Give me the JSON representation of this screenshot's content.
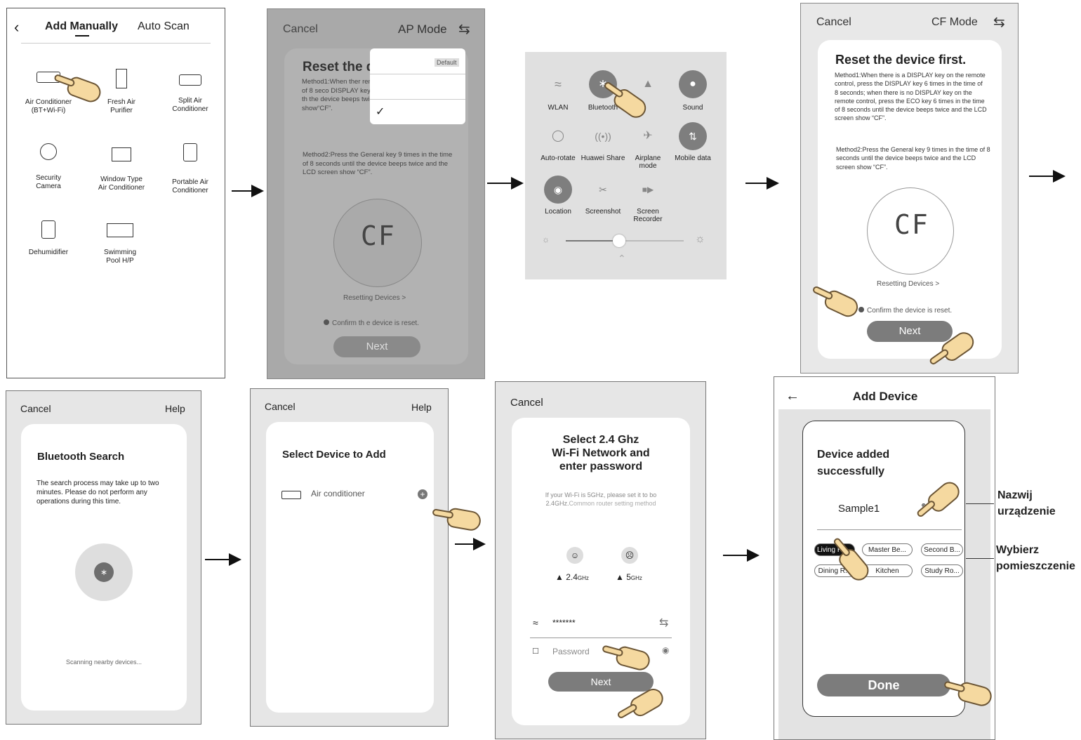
{
  "panel1": {
    "back_icon": "chevron-left-icon",
    "tab_manual": "Add Manually",
    "tab_auto": "Auto Scan",
    "devices": [
      {
        "label_line1": "Air Conditioner",
        "label_line2": "(BT+Wi-Fi)",
        "icon": "air-conditioner-icon"
      },
      {
        "label_line1": "Fresh Air",
        "label_line2": "Purifier",
        "icon": "air-purifier-icon"
      },
      {
        "label_line1": "Split Air",
        "label_line2": "Conditioner",
        "icon": "split-ac-icon"
      },
      {
        "label_line1": "Security",
        "label_line2": "Camera",
        "icon": "camera-icon"
      },
      {
        "label_line1": "Window Type",
        "label_line2": "Air Conditioner",
        "icon": "window-ac-icon"
      },
      {
        "label_line1": "Portable Air",
        "label_line2": "Conditioner",
        "icon": "portable-ac-icon"
      },
      {
        "label_line1": "Dehumidifier",
        "label_line2": "",
        "icon": "dehumidifier-icon"
      },
      {
        "label_line1": "Swimming",
        "label_line2": "Pool H/P",
        "icon": "pool-heat-pump-icon"
      }
    ]
  },
  "panel2": {
    "cancel": "Cancel",
    "mode": "AP Mode",
    "title": "Reset the d",
    "dropdown_default": "Default",
    "method1": "Method1:When ther remote control, pres in the time of 8 seco DISPLAY key on the r ECO key 6 times in th the device beeps twice and the LCD screen show“CF”.",
    "method2": "Method2:Press the General key 9 times in the time of 8 seconds until the device beeps twice and the LCD screen show “CF”.",
    "lcd": "CF",
    "resetting": "Resetting Devices >",
    "confirm": "Confirm th e device is reset.",
    "next": "Next"
  },
  "panel3": {
    "tiles": [
      {
        "label": "WLAN",
        "icon": "wifi-icon"
      },
      {
        "label": "Bluetooth",
        "icon": "bluetooth-icon"
      },
      {
        "label": "",
        "icon": "flashlight-icon"
      },
      {
        "label": "Sound",
        "icon": "bell-icon"
      },
      {
        "label": "Auto-rotate",
        "icon": "rotate-icon"
      },
      {
        "label": "Huawei Share",
        "icon": "share-icon"
      },
      {
        "label": "Airplane mode",
        "icon": "airplane-icon"
      },
      {
        "label": "Mobile data",
        "icon": "mobile-data-icon"
      },
      {
        "label": "Location",
        "icon": "location-icon"
      },
      {
        "label": "Screenshot",
        "icon": "screenshot-icon"
      },
      {
        "label": "Screen Recorder",
        "icon": "screen-recorder-icon"
      }
    ],
    "brightness_level": 0.45
  },
  "panel4": {
    "cancel": "Cancel",
    "mode": "CF Mode",
    "title": "Reset the device first.",
    "method1": "Method1:When there is a DISPLAY key on the remote control, press the DISPLAY key 6 times in the time of 8 seconds; when there is no DISPLAY key on the remote control, press the ECO key 6 times in the time of 8 seconds until the device beeps twice and the LCD screen show “CF”.",
    "method2": "Method2:Press the General key 9 times in the time of 8 seconds until the device beeps twice and the LCD screen show “CF”.",
    "lcd": "CF",
    "resetting": "Resetting Devices >",
    "confirm": "Confirm the device is reset.",
    "next": "Next"
  },
  "panel5": {
    "cancel": "Cancel",
    "help": "Help",
    "title": "Bluetooth Search",
    "body": "The search process may take up to two minutes. Please do not perform any operations during this time.",
    "status": "Scanning nearby devices..."
  },
  "panel6": {
    "cancel": "Cancel",
    "help": "Help",
    "title": "Select Device to Add",
    "item": "Air conditioner"
  },
  "panel7": {
    "cancel": "Cancel",
    "title_line1": "Select 2.4 Ghz",
    "title_line2": "Wi-Fi Network and",
    "title_line3": "enter password",
    "note_a": "If your Wi-Fi is 5GHz, please set it to bo 2.4GHz.",
    "note_b": "Common router setting method",
    "band_24": "2.4",
    "band_24_unit": "GHz",
    "band_5": "5",
    "band_5_unit": "GHz",
    "ssid": "*******",
    "password_placeholder": "Password",
    "next": "Next"
  },
  "panel8": {
    "title": "Add Device",
    "success_line1": "Device added",
    "success_line2": "successfully",
    "device_name": "Sample1",
    "rooms": [
      "Living Ro...",
      "Master Be...",
      "Second B...",
      "Dining R...",
      "Kitchen",
      "Study Ro..."
    ],
    "done": "Done"
  },
  "annotations": {
    "rename_line1": "Nazwij",
    "rename_line2": "urządzenie",
    "room_line1": "Wybierz",
    "room_line2": "pomieszczenie"
  }
}
